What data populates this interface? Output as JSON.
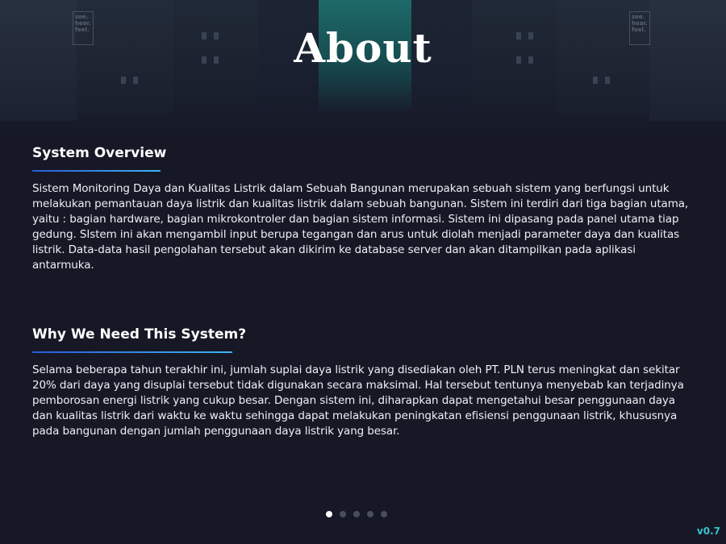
{
  "header": {
    "title": "About"
  },
  "signs": {
    "left": "see. hear. feel.",
    "right": "see. hear. feel."
  },
  "sections": [
    {
      "heading": "System Overview",
      "body": "Sistem Monitoring Daya dan Kualitas Listrik dalam Sebuah Bangunan merupakan sebuah sistem yang berfungsi untuk melakukan pemantauan daya listrik dan kualitas listrik dalam sebuah bangunan. Sistem ini terdiri dari tiga bagian utama, yaitu : bagian hardware, bagian mikrokontroler dan bagian sistem informasi. Sistem ini dipasang pada panel utama tiap gedung. SIstem ini akan mengambil input berupa tegangan dan arus untuk diolah menjadi parameter daya dan kualitas listrik. Data-data hasil pengolahan tersebut akan dikirim ke database server dan akan ditampilkan pada aplikasi antarmuka."
    },
    {
      "heading": "Why We Need This System?",
      "body": "Selama beberapa tahun terakhir ini, jumlah suplai daya listrik yang disediakan oleh PT. PLN terus meningkat dan sekitar 20% dari daya yang disuplai tersebut tidak digunakan secara maksimal. Hal tersebut tentunya menyebab kan terjadinya pemborosan energi listrik yang cukup besar. Dengan sistem ini, diharapkan dapat mengetahui besar penggunaan daya dan kualitas listrik dari waktu ke waktu sehingga dapat melakukan peningkatan efisiensi penggunaan listrik, khususnya pada bangunan dengan jumlah penggunaan daya listrik yang besar."
    }
  ],
  "pagination": {
    "total": 5,
    "active_index": 0
  },
  "footer": {
    "version": "v0.7"
  },
  "colors": {
    "accent_start": "#2b5bd6",
    "accent_end": "#3fb4f2",
    "version": "#39c3c9",
    "background": "#161826"
  }
}
